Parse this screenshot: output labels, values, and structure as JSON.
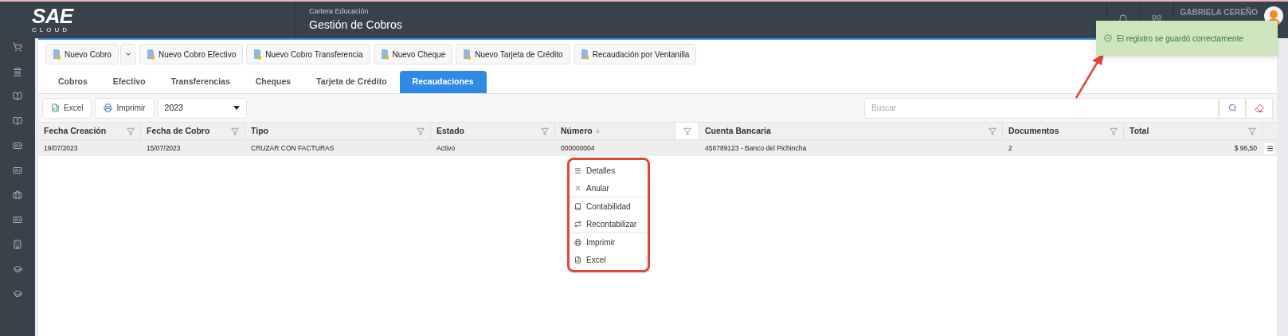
{
  "header": {
    "logo": "SAE",
    "logo_sub": "CLOUD",
    "module": "Cartera Educación",
    "title": "Gestión de Cobros",
    "user": "GABRIELA CEREÑO"
  },
  "actions": [
    {
      "label": "Nuevo Cobro",
      "has_menu": true
    },
    {
      "label": "Nuevo Cobro Efectivo",
      "has_menu": false
    },
    {
      "label": "Nuevo Cobro Transferencia",
      "has_menu": false
    },
    {
      "label": "Nuevo Cheque",
      "has_menu": false
    },
    {
      "label": "Nuevo Tarjeta de Crédito",
      "has_menu": false
    },
    {
      "label": "Recaudación por Ventanilla",
      "has_menu": false
    }
  ],
  "tabs": [
    {
      "label": "Cobros",
      "selected": false
    },
    {
      "label": "Efectivo",
      "selected": false
    },
    {
      "label": "Transferencias",
      "selected": false
    },
    {
      "label": "Cheques",
      "selected": false
    },
    {
      "label": "Tarjeta de Crédito",
      "selected": false
    },
    {
      "label": "Recaudaciones",
      "selected": true
    }
  ],
  "toolbar": {
    "excel": "Excel",
    "print": "Imprimir",
    "year": "2023",
    "search": {
      "placeholder": "Buscar"
    }
  },
  "table": {
    "columns": [
      {
        "label": "Fecha Creación",
        "sort_desc": false
      },
      {
        "label": "Fecha de Cobro",
        "sort_desc": false
      },
      {
        "label": "Tipo",
        "sort_desc": false
      },
      {
        "label": "Estado",
        "sort_desc": false
      },
      {
        "label": "Número",
        "sort_desc": true
      },
      {
        "label": "Cuenta Bancaria",
        "sort_desc": false
      },
      {
        "label": "Documentos",
        "sort_desc": false
      },
      {
        "label": "Total",
        "sort_desc": false
      }
    ],
    "rows": [
      {
        "cells": [
          "19/07/2023",
          "15/07/2023",
          "CRUZAR CON FACTURAS",
          "Activo",
          "000000004",
          "456789123 - Banco del Pichincha",
          "2",
          "$ 96,50"
        ]
      }
    ]
  },
  "context_menu": {
    "groups": [
      {
        "items": [
          {
            "kind": "details",
            "label": "Detalles"
          },
          {
            "kind": "cancel",
            "label": "Anular"
          }
        ]
      },
      {
        "items": [
          {
            "kind": "book",
            "label": "Contabilidad"
          },
          {
            "kind": "repost",
            "label": "Recontabilizar"
          }
        ]
      },
      {
        "items": [
          {
            "kind": "print",
            "label": "Imprimir"
          },
          {
            "kind": "excel",
            "label": "Excel"
          }
        ]
      }
    ]
  },
  "toast": {
    "message": "El registro se guardó correctamente"
  }
}
